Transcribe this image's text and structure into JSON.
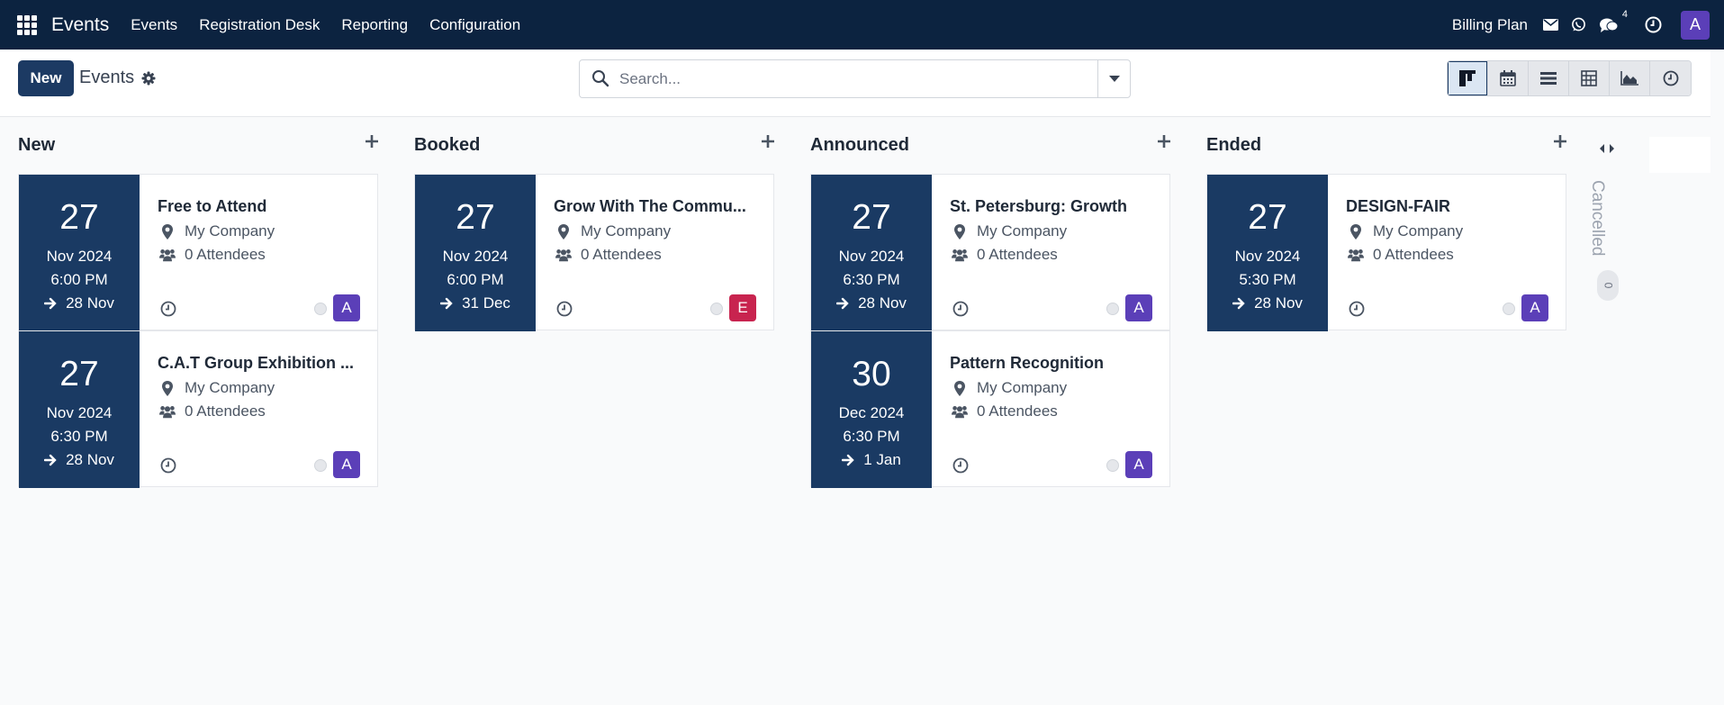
{
  "navbar": {
    "brand": "Events",
    "menu": [
      "Events",
      "Registration Desk",
      "Reporting",
      "Configuration"
    ],
    "billing": "Billing Plan",
    "message_count": "4",
    "user_initial": "A"
  },
  "control": {
    "new_label": "New",
    "breadcrumb": "Events",
    "search_placeholder": "Search...",
    "views": [
      "kanban",
      "calendar",
      "list",
      "pivot",
      "graph",
      "activity"
    ],
    "active_view": "kanban"
  },
  "columns": [
    {
      "title": "New",
      "cards": [
        {
          "title": "Free to Attend",
          "day": "27",
          "month": "Nov 2024",
          "time": "6:00 PM",
          "end": "28 Nov",
          "company": "My Company",
          "attendees": "0 Attendees",
          "avatar": "A",
          "avatar_color": "#5b3fb8"
        },
        {
          "title": "C.A.T Group Exhibition ...",
          "day": "27",
          "month": "Nov 2024",
          "time": "6:30 PM",
          "end": "28 Nov",
          "company": "My Company",
          "attendees": "0 Attendees",
          "avatar": "A",
          "avatar_color": "#5b3fb8"
        }
      ]
    },
    {
      "title": "Booked",
      "cards": [
        {
          "title": "Grow With The Commu...",
          "day": "27",
          "month": "Nov 2024",
          "time": "6:00 PM",
          "end": "31 Dec",
          "company": "My Company",
          "attendees": "0 Attendees",
          "avatar": "E",
          "avatar_color": "#c8244f"
        }
      ]
    },
    {
      "title": "Announced",
      "cards": [
        {
          "title": "St. Petersburg: Growth",
          "day": "27",
          "month": "Nov 2024",
          "time": "6:30 PM",
          "end": "28 Nov",
          "company": "My Company",
          "attendees": "0 Attendees",
          "avatar": "A",
          "avatar_color": "#5b3fb8"
        },
        {
          "title": "Pattern Recognition",
          "day": "30",
          "month": "Dec 2024",
          "time": "6:30 PM",
          "end": "1 Jan",
          "company": "My Company",
          "attendees": "0 Attendees",
          "avatar": "A",
          "avatar_color": "#5b3fb8"
        }
      ]
    },
    {
      "title": "Ended",
      "cards": [
        {
          "title": "DESIGN-FAIR",
          "day": "27",
          "month": "Nov 2024",
          "time": "5:30 PM",
          "end": "28 Nov",
          "company": "My Company",
          "attendees": "0 Attendees",
          "avatar": "A",
          "avatar_color": "#5b3fb8"
        }
      ]
    }
  ],
  "folded_column": {
    "title": "Cancelled",
    "count": "0"
  }
}
